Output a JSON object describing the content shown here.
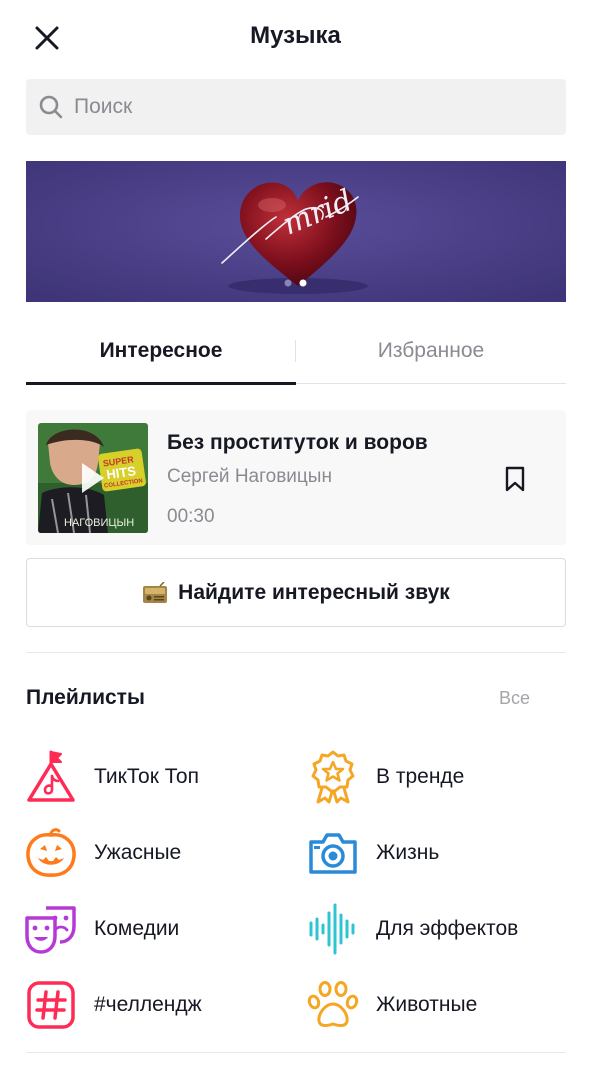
{
  "header": {
    "title": "Музыка"
  },
  "search": {
    "placeholder": "Поиск"
  },
  "banner": {
    "logo_text": "mrid"
  },
  "tabs": [
    {
      "label": "Интересное",
      "active": true
    },
    {
      "label": "Избранное",
      "active": false
    }
  ],
  "track": {
    "title": "Без проституток и воров",
    "artist": "Сергей Наговицын",
    "duration": "00:30",
    "cover_text_1": "SUPER",
    "cover_text_2": "HITS",
    "cover_text_3": "COLLECTION",
    "cover_text_4": "НАГОВИЦЫН"
  },
  "find_button": {
    "label": "Найдите интересный звук",
    "icon": "radio-icon"
  },
  "playlists": {
    "title": "Плейлисты",
    "all_label": "Все",
    "items": [
      {
        "label": "ТикТок Топ",
        "icon": "tiktok-top-icon",
        "color": "#fe2c55"
      },
      {
        "label": "В тренде",
        "icon": "medal-star-icon",
        "color": "#f5a623"
      },
      {
        "label": "Ужасные",
        "icon": "pumpkin-icon",
        "color": "#ff7a1a"
      },
      {
        "label": "Жизнь",
        "icon": "camera-icon",
        "color": "#2a8ad8"
      },
      {
        "label": "Комедии",
        "icon": "theater-masks-icon",
        "color": "#b638d6"
      },
      {
        "label": "Для эффектов",
        "icon": "sound-wave-icon",
        "color": "#2ec5d3"
      },
      {
        "label": "#челлендж",
        "icon": "hashtag-icon",
        "color": "#fe2c55"
      },
      {
        "label": "Животные",
        "icon": "paw-icon",
        "color": "#f5a623"
      }
    ]
  }
}
